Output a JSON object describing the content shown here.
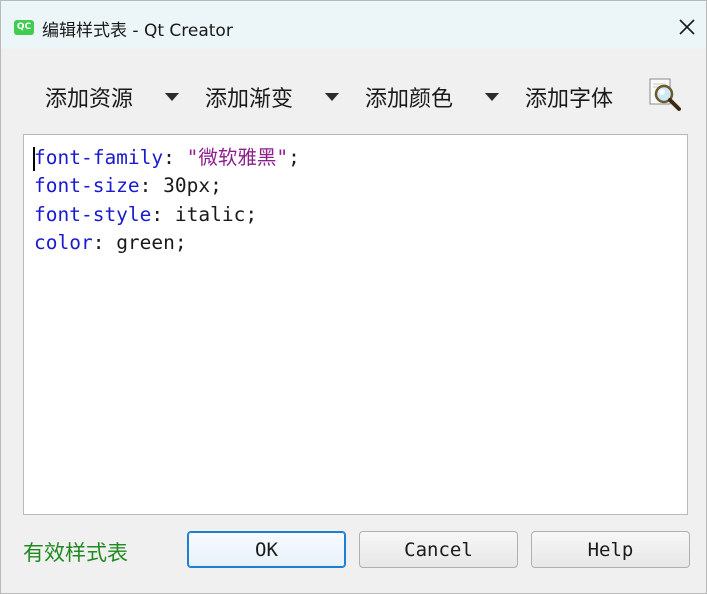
{
  "window": {
    "title": "编辑样式表 - Qt Creator",
    "app_icon_text": "QC"
  },
  "toolbar": {
    "add_resource": "添加资源",
    "add_gradient": "添加渐变",
    "add_color": "添加颜色",
    "add_font": "添加字体"
  },
  "editor": {
    "lines": [
      {
        "property": "font-family",
        "sep": ": ",
        "value": "\"微软雅黑\"",
        "end": ";"
      },
      {
        "property": "font-size",
        "sep": ": ",
        "value": "30px",
        "end": ";"
      },
      {
        "property": "font-style",
        "sep": ": ",
        "value": "italic",
        "end": ";"
      },
      {
        "property": "color",
        "sep": ": ",
        "value": "green",
        "end": ";"
      }
    ]
  },
  "status": {
    "text": "有效样式表",
    "color": "#1f8a1f"
  },
  "buttons": {
    "ok": "OK",
    "cancel": "Cancel",
    "help": "Help"
  },
  "colors": {
    "property": "#1a1acf",
    "string": "#8b1f8b",
    "titlebar": "#ecf5f7",
    "default_button_border": "#1e7fd0"
  },
  "icons": {
    "app": "qt-creator-icon",
    "close": "close-icon",
    "dropdown": "dropdown-arrow-icon",
    "search": "magnifier-document-icon"
  }
}
